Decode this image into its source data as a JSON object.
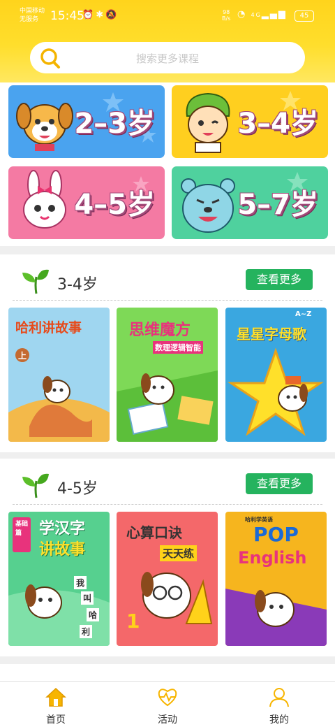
{
  "status_bar": {
    "carrier_1": "中国移动",
    "carrier_2": "无服务",
    "time": "15:45",
    "net_speed_value": "98",
    "net_speed_unit": "B/s",
    "signal": "4G",
    "battery": "45"
  },
  "search": {
    "placeholder": "搜索更多课程"
  },
  "age_cards": [
    {
      "label": "2–3岁",
      "bg": "#4aa3ef"
    },
    {
      "label": "3–4岁",
      "bg": "#ffcf1f"
    },
    {
      "label": "4–5岁",
      "bg": "#f47aa3"
    },
    {
      "label": "5–7岁",
      "bg": "#4fd19e"
    }
  ],
  "sections": [
    {
      "title": "3-4岁",
      "more_label": "查看更多",
      "books": [
        {
          "title": "哈利讲故事",
          "tag": "上"
        },
        {
          "title": "思维魔方",
          "subtitle": "数理逻辑智能"
        },
        {
          "title": "星星字母歌",
          "tag": "A~Z"
        }
      ]
    },
    {
      "title": "4-5岁",
      "more_label": "查看更多",
      "books": [
        {
          "title": "学汉字",
          "title2": "讲故事",
          "tag": "基础篇",
          "chars": [
            "我",
            "叫",
            "哈",
            "利"
          ]
        },
        {
          "title": "心算口诀",
          "subtitle": "天天练"
        },
        {
          "title": "POP",
          "title2": "English",
          "subtitle": "哈利学英语"
        }
      ]
    }
  ],
  "tabbar": {
    "items": [
      {
        "label": "首页",
        "active": true
      },
      {
        "label": "活动",
        "active": false
      },
      {
        "label": "我的",
        "active": false
      }
    ]
  },
  "colors": {
    "accent": "#ffd41c",
    "more_button": "#25b35e"
  }
}
